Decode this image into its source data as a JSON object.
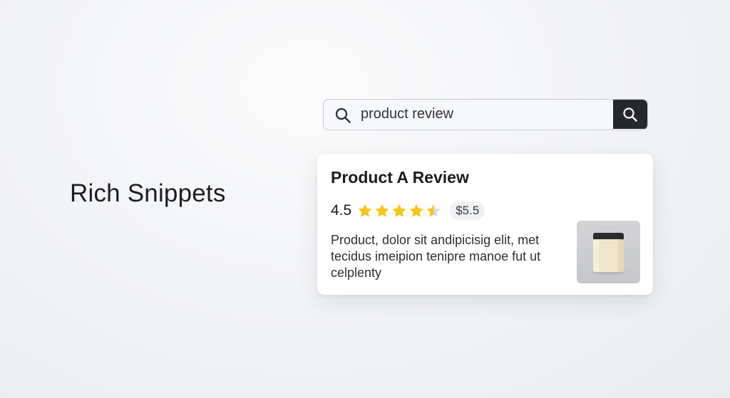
{
  "heading": "Rich Snippets",
  "search": {
    "value": "product review",
    "lead_icon": "search-icon",
    "button_icon": "search-icon"
  },
  "result": {
    "title": "Product A Review",
    "rating_value": "4.5",
    "rating": 4.5,
    "rating_max": 5,
    "price": "$5.5",
    "description": "Product, dolor sit andipicisig elit, met tecidus imeipion tenipre manoe fut ut celplenty",
    "thumbnail_icon": "product-jar-image"
  },
  "colors": {
    "star": "#f5c518",
    "search_button_bg": "#26282c",
    "jar_lid": "#2b2b2d",
    "jar_body": "#efe6c9"
  }
}
